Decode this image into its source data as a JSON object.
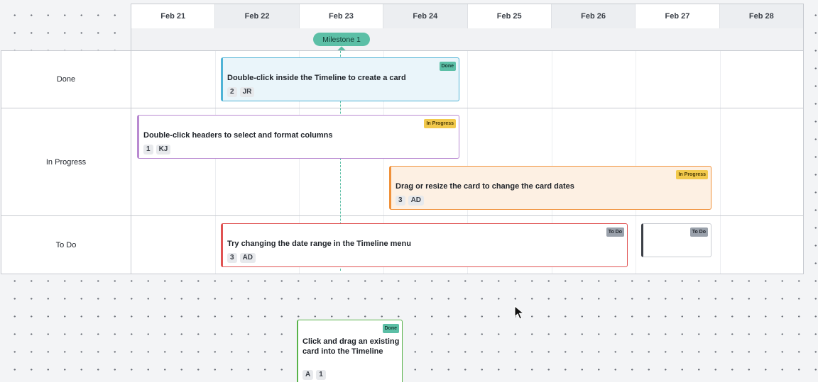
{
  "dates": [
    "Feb 21",
    "Feb 22",
    "Feb 23",
    "Feb 24",
    "Feb 25",
    "Feb 26",
    "Feb 27",
    "Feb 28"
  ],
  "milestone": {
    "label": "Milestone 1"
  },
  "lanes": [
    {
      "label": "Done"
    },
    {
      "label": "In Progress"
    },
    {
      "label": "To Do"
    }
  ],
  "cards": [
    {
      "title": "Double-click inside the Timeline to create a card",
      "badge": "Done",
      "meta": [
        "2",
        "JR"
      ],
      "color": "#4fb3d6"
    },
    {
      "title": "Double-click headers to select and format columns",
      "badge": "In Progress",
      "meta": [
        "1",
        "KJ"
      ],
      "color": "#b98ad1"
    },
    {
      "title": "Drag or resize the card to change the card dates",
      "badge": "In Progress",
      "meta": [
        "3",
        "AD"
      ],
      "color": "#f0913a"
    },
    {
      "title": "Try changing the date range in the Timeline menu",
      "badge": "To Do",
      "meta": [
        "3",
        "AD"
      ],
      "color": "#e05252"
    },
    {
      "title": "",
      "badge": "To Do",
      "meta": [],
      "color": "#3b3f46"
    }
  ],
  "floating_card": {
    "title_line1": "Click and drag an existing",
    "title_line2": "card into the Timeline",
    "badge": "Done",
    "meta": [
      "A",
      "1"
    ],
    "color": "#58b34a"
  }
}
